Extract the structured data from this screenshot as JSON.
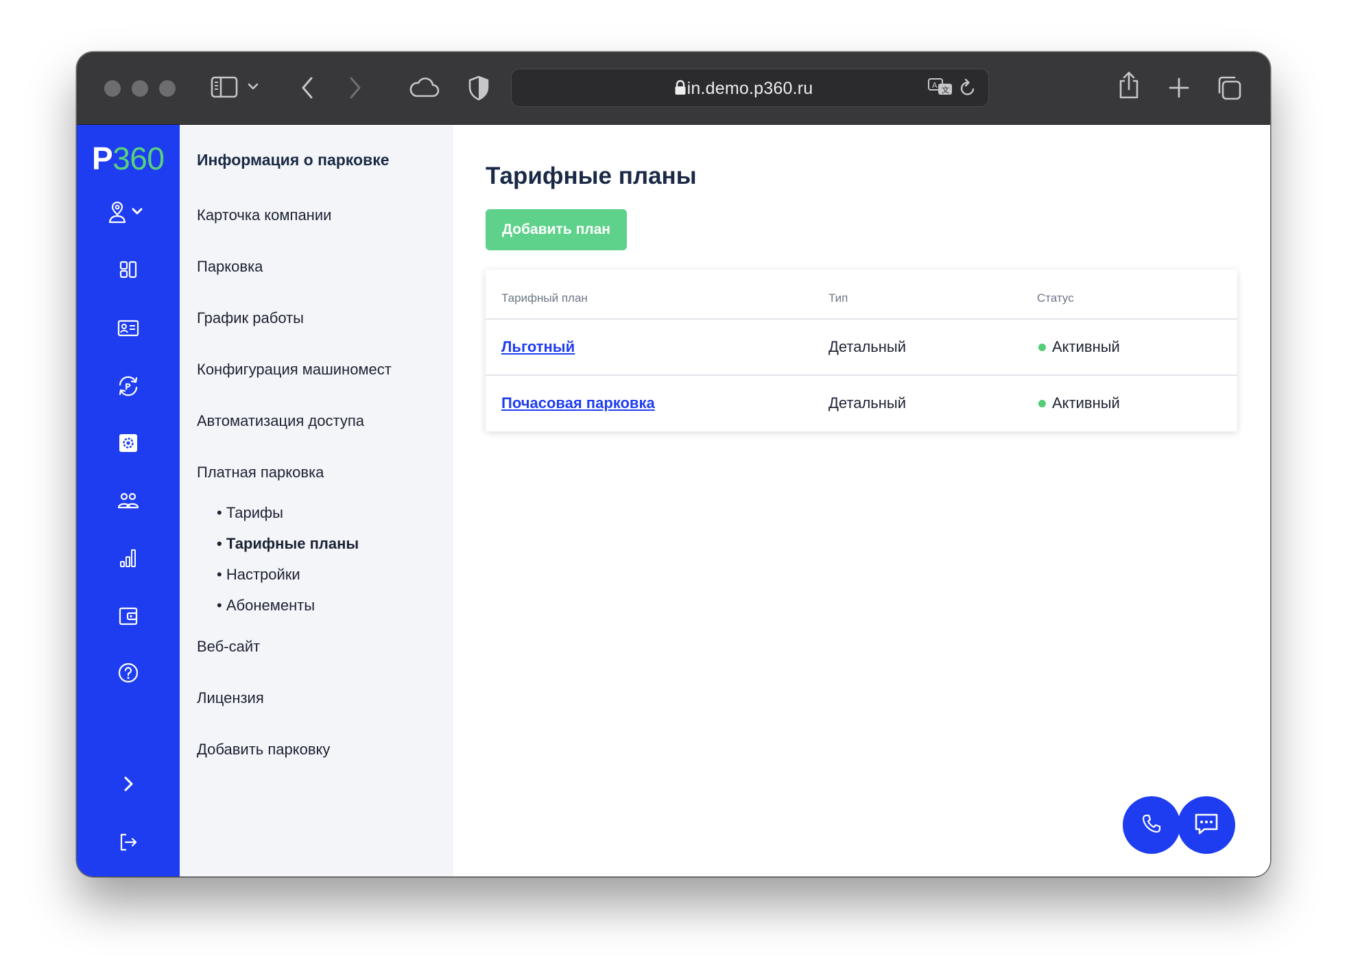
{
  "browser": {
    "url": "in.demo.p360.ru"
  },
  "logo": {
    "letter": "P",
    "number": "360"
  },
  "subnav": {
    "heading": "Информация о парковке",
    "items": [
      "Карточка компании",
      "Парковка",
      "График работы",
      "Конфигурация машиномест",
      "Автоматизация доступа",
      "Платная парковка"
    ],
    "paid_sub": [
      "• Тарифы",
      "• Тарифные планы",
      "• Настройки",
      "• Абонементы"
    ],
    "items_after": [
      "Веб-сайт",
      "Лицензия",
      "Добавить парковку"
    ]
  },
  "main": {
    "title": "Тарифные планы",
    "add_button": "Добавить план",
    "table": {
      "headers": [
        "Тарифный план",
        "Тип",
        "Статус"
      ],
      "rows": [
        {
          "name": "Льготный",
          "type": "Детальный",
          "status": "Активный"
        },
        {
          "name": "Почасовая парковка",
          "type": "Детальный",
          "status": "Активный"
        }
      ]
    }
  },
  "colors": {
    "brand_blue": "#1f3df0",
    "accent_green": "#58d27a",
    "button_green": "#5ed18a",
    "status_active": "#56cc76"
  },
  "icons": {
    "rail": [
      "location-user-icon",
      "dashboard-icon",
      "id-card-icon",
      "parking-sync-icon",
      "settings-icon",
      "users-icon",
      "stats-icon",
      "wallet-icon",
      "help-icon",
      "expand-icon",
      "logout-icon"
    ],
    "fab": [
      "phone-icon",
      "chat-icon"
    ]
  }
}
